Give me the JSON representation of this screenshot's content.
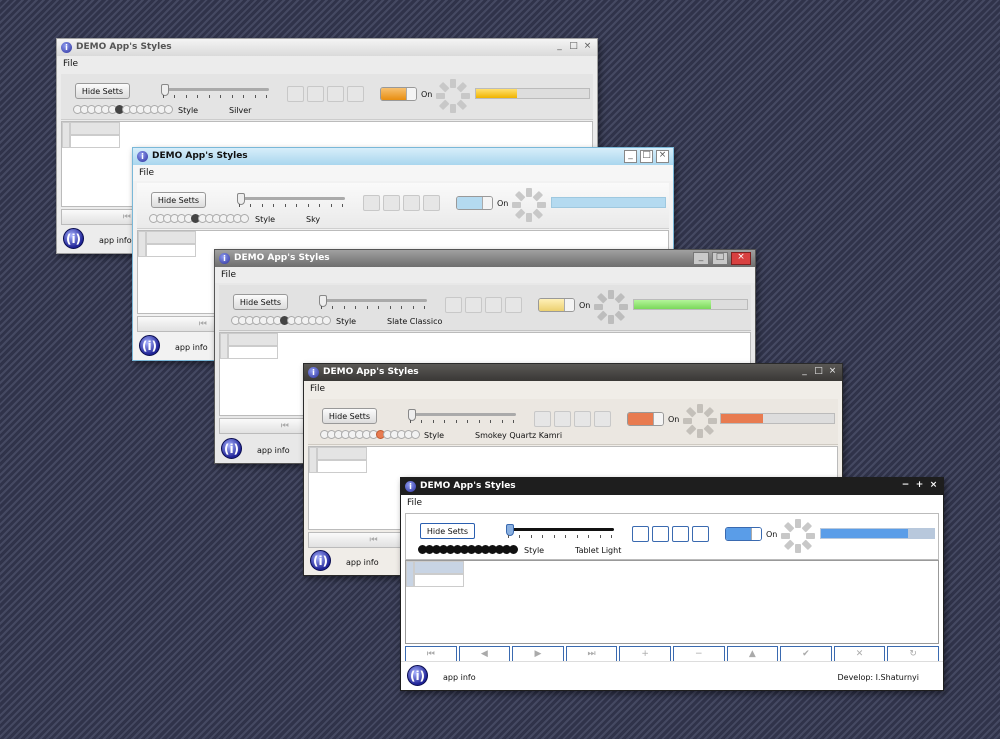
{
  "app": {
    "title": "DEMO App's Styles",
    "menu_file": "File",
    "hide_setts_label": "Hide Setts",
    "style_label": "Style",
    "toggle_label": "On",
    "app_info_label": "app info",
    "logo_glyph": "(i)",
    "develop_label": "Develop: I.Shaturnyi"
  },
  "windows": [
    {
      "style_name": "Silver",
      "accent": "#f0a020",
      "progress": 0.36
    },
    {
      "style_name": "Sky",
      "accent": "#b4daf0",
      "progress": 1.0
    },
    {
      "style_name": "Slate Classico",
      "accent": "#8fe070",
      "progress": 0.68
    },
    {
      "style_name": "Smokey Quartz Kamri",
      "accent": "#e87b50",
      "progress": 0.37
    },
    {
      "style_name": "Tablet Light",
      "accent": "#5a9de8",
      "progress": 0.77
    }
  ],
  "window_controls": {
    "minimize": "_",
    "maximize": "□",
    "close": "×",
    "tablet_minimize": "−",
    "tablet_maximize": "+",
    "tablet_close": "×"
  },
  "navigator": {
    "first": "⏮",
    "prior": "◀",
    "next": "▶",
    "last": "⏭",
    "insert": "+",
    "delete": "−",
    "edit": "▲",
    "post": "✔",
    "cancel": "✕",
    "refresh": "↻"
  },
  "icons": [
    "app-icon",
    "gear-icon"
  ]
}
